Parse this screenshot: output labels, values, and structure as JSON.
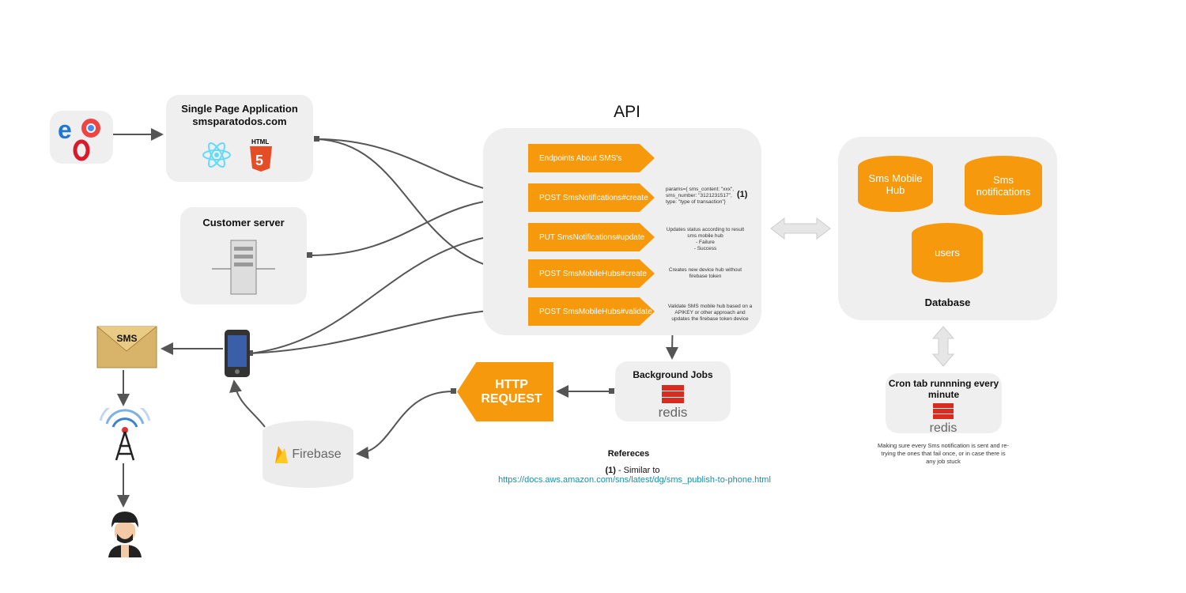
{
  "spa": {
    "title": "Single Page Application",
    "subtitle": "smsparatodos.com"
  },
  "customer_server": {
    "title": "Customer server"
  },
  "api": {
    "title": "API",
    "endpoints": [
      {
        "label": "Endpoints About SMS's"
      },
      {
        "label": "POST SmsNotifications#create",
        "note": "params={ sms_content: \"xxx\", sms_number: \"3121231517\", type: \"type of transaction\"}"
      },
      {
        "label": "PUT SmsNotifications#update",
        "note": "Updates status according to result sms mobile hub\n- Failure\n- Success"
      },
      {
        "label": "POST SmsMobileHubs#create",
        "note": "Creates new device hub without firebase token"
      },
      {
        "label": "POST SmsMobileHubs#validate",
        "note": "Validate SMS mobile hub based on a APIKEY or other approach and updates the firebase token device"
      }
    ],
    "ref_marker": "(1)"
  },
  "database": {
    "title": "Database",
    "tables": [
      "Sms Mobile Hub",
      "Sms notifications",
      "users"
    ]
  },
  "cron": {
    "title": "Cron tab runnning every minute",
    "logo": "redis",
    "note": "Making sure every Sms notification is sent and re-trying the ones that fail once, or in case there is any job stuck"
  },
  "background_jobs": {
    "title": "Background Jobs",
    "logo": "redis"
  },
  "http_request": {
    "label": "HTTP REQUEST"
  },
  "firebase": {
    "label": "Firebase"
  },
  "sms": {
    "label": "SMS"
  },
  "references": {
    "title": "Refereces",
    "marker": "(1)",
    "text": " - Similar to",
    "link": "https://docs.aws.amazon.com/sns/latest/dg/sms_publish-to-phone.html"
  },
  "colors": {
    "accent": "#f7990c",
    "box": "#efefef",
    "line": "#555555",
    "redis": "#d82c20"
  }
}
